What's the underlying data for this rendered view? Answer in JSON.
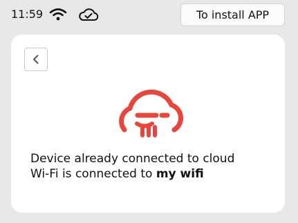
{
  "status_bar": {
    "time": "11:59",
    "icons": [
      "wifi-icon",
      "cloud-check-icon"
    ],
    "install_button_label": "To install APP"
  },
  "card": {
    "back_icon": "chevron-left-icon",
    "logo_icon": "cloud-logo-icon",
    "logo_color": "#e8453c",
    "message_line_1": "Device already connected to cloud",
    "message_line_2_prefix": "Wi-Fi is connected to ",
    "wifi_name": "my wifi"
  }
}
